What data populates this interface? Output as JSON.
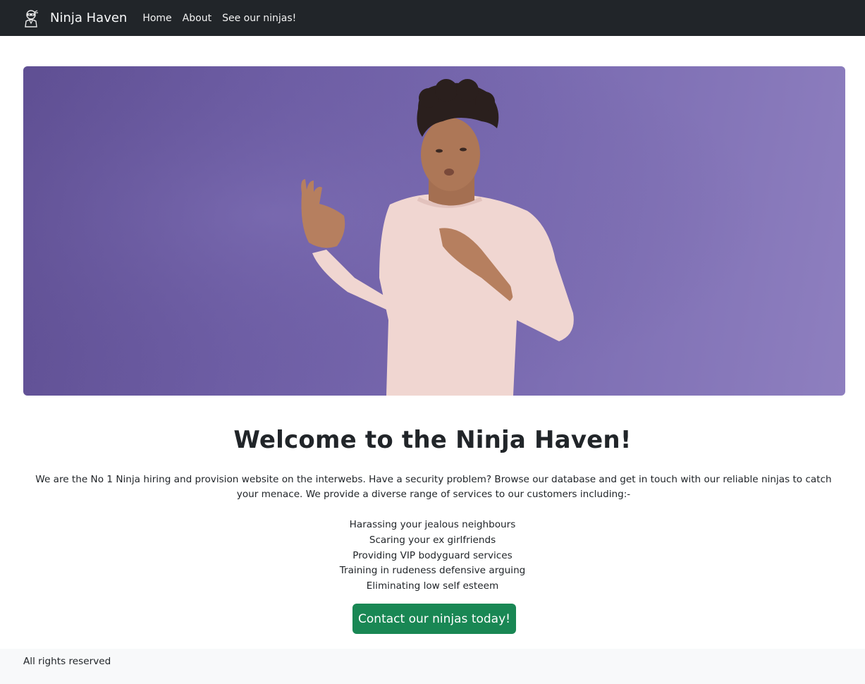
{
  "navbar": {
    "brand": "Ninja Haven",
    "brand_icon": "ninja-logo-icon",
    "links": [
      "Home",
      "About",
      "See our ninjas!"
    ]
  },
  "hero": {
    "image": "photo of young man in pink sweatshirt doing karate pose on purple background"
  },
  "main": {
    "title": "Welcome to the Ninja Haven!",
    "intro": "We are the No 1 Ninja hiring and provision website on the interwebs. Have a security problem? Browse our database and get in touch with our reliable ninjas to catch your menace. We provide a diverse range of services to our customers including:-",
    "services": [
      "Harassing your jealous neighbours",
      "Scaring your ex girlfriends",
      "Providing VIP bodyguard services",
      "Training in rudeness defensive arguing",
      "Eliminating low self esteem"
    ],
    "cta_label": "Contact our ninjas today!"
  },
  "footer": {
    "text": "All rights reserved"
  },
  "colors": {
    "navbar_bg": "#212529",
    "hero_bg": "#7a6bb1",
    "cta_bg": "#198754",
    "footer_bg": "#f8f9fa"
  }
}
